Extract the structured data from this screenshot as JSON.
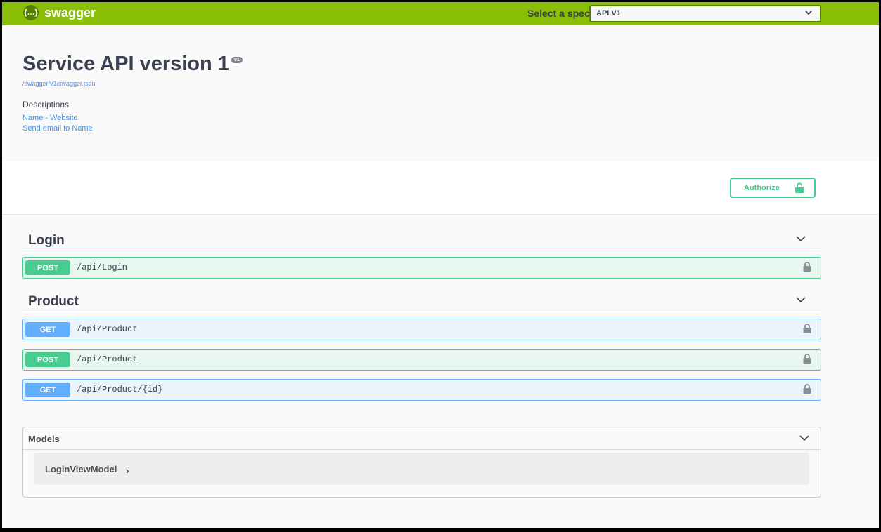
{
  "topbar": {
    "logo_glyph": "{…}",
    "logo_text": "swagger",
    "spec_label": "Select a spec",
    "spec_value": "API V1",
    "color": "#89bf04"
  },
  "info": {
    "title": "Service API version 1",
    "version_badge": "v1",
    "spec_url": "/swagger/v1/swagger.json",
    "description_heading": "Descriptions",
    "contact_link": "Name - Website",
    "email_link": "Send email to Name"
  },
  "scheme": {
    "authorize_label": "Authorize"
  },
  "tags": [
    {
      "name": "Login",
      "operations": [
        {
          "method": "POST",
          "path": "/api/Login"
        }
      ]
    },
    {
      "name": "Product",
      "operations": [
        {
          "method": "GET",
          "path": "/api/Product"
        },
        {
          "method": "POST",
          "path": "/api/Product"
        },
        {
          "method": "GET",
          "path": "/api/Product/{id}"
        }
      ]
    }
  ],
  "models": {
    "heading": "Models",
    "items": [
      {
        "name": "LoginViewModel"
      }
    ]
  },
  "colors": {
    "post": "#49cc90",
    "get": "#61affe"
  }
}
